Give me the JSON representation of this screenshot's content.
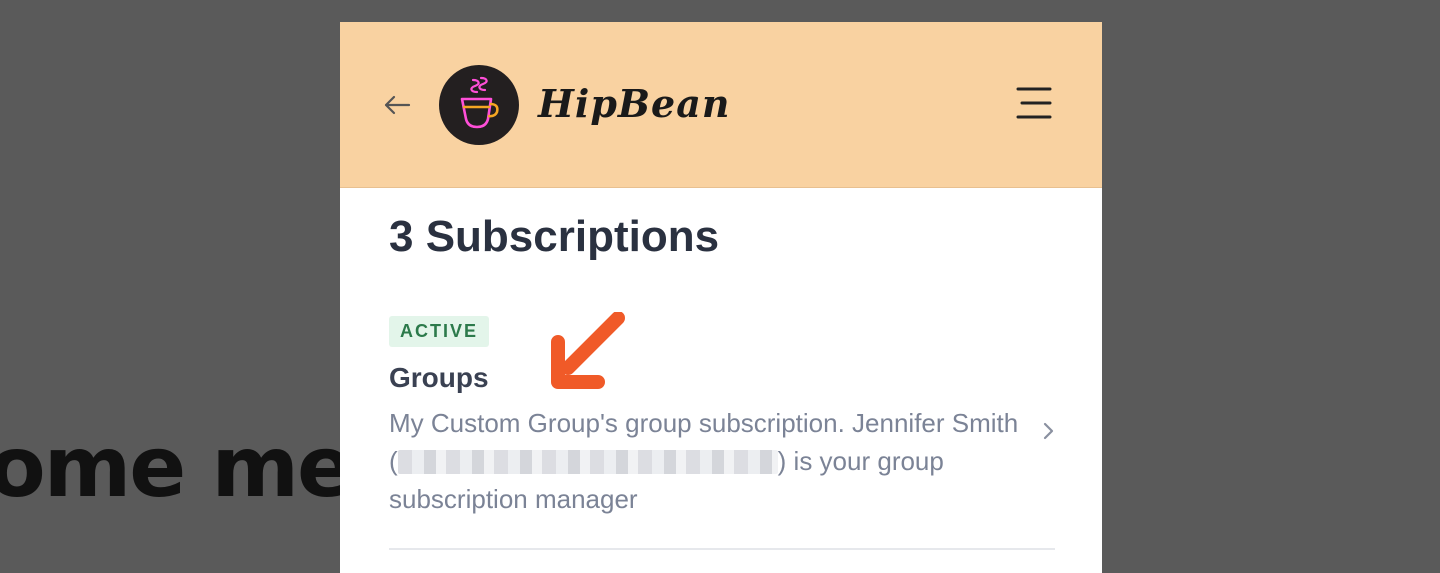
{
  "background": {
    "partial_text": "ome me"
  },
  "header": {
    "brand": "HipBean",
    "bg_color": "#f9d2a1",
    "back_icon": "arrow-left-icon",
    "logo_icon": "coffee-cup-icon",
    "menu_icon": "hamburger-menu-icon"
  },
  "main": {
    "title": "3 Subscriptions",
    "subscriptions": [
      {
        "status": "ACTIVE",
        "name": "Groups",
        "description_before": "My Custom Group's group subscription. Jennifer Smith (",
        "description_after": ") is your group subscription manager"
      }
    ]
  },
  "colors": {
    "accent_arrow": "#f05a28",
    "active_badge_bg": "#e3f5ea",
    "active_badge_text": "#2c7a4b"
  }
}
